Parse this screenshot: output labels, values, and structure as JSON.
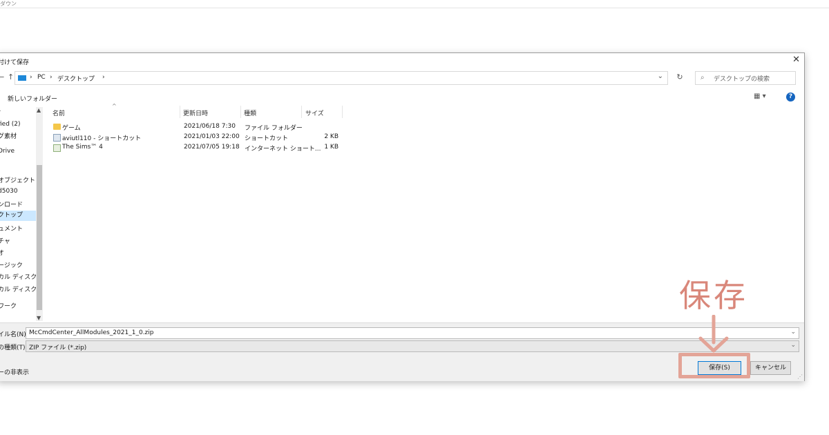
{
  "browser": {
    "tab_label": "ダウン"
  },
  "dialog": {
    "title": "付けて保存",
    "close_glyph": "✕",
    "nav": {
      "back_glyph": "←",
      "up_glyph": "↑",
      "breadcrumb": [
        "PC",
        "デスクトップ"
      ],
      "separator": "›",
      "dropdown_glyph": "⌄",
      "refresh_glyph": "↻",
      "search_placeholder": "デスクトップの検索"
    },
    "toolbar": {
      "new_folder": "新しいフォルダー",
      "view_glyph": "▦ ▾",
      "help_glyph": "?"
    },
    "sidebar": {
      "items": [
        "r",
        "fied (2)",
        "グ素材",
        "Drive",
        "オブジェクト",
        "d5030",
        "ンロード",
        "クトップ",
        "ュメント",
        "チャ",
        "オ",
        "ージック",
        "カル ディスク (C",
        "カル ディスク (C",
        "ワーク"
      ],
      "selected_index": 7
    },
    "columns": {
      "name": "名前",
      "date": "更新日時",
      "type": "種類",
      "size": "サイズ",
      "sort_glyph": "^"
    },
    "files": [
      {
        "name": "ゲーム",
        "date": "2021/06/18 7:30",
        "type": "ファイル フォルダー",
        "size": "",
        "icon": "folder-icon"
      },
      {
        "name": "aviutl110 - ショートカット",
        "date": "2021/01/03 22:00",
        "type": "ショートカット",
        "size": "2 KB",
        "icon": "shortcut-icon"
      },
      {
        "name": "The Sims™ 4",
        "date": "2021/07/05 19:18",
        "type": "インターネット ショート...",
        "size": "1 KB",
        "icon": "internet-shortcut-icon"
      }
    ],
    "footer": {
      "filename_label": "イル名(N):",
      "filename_value": "McCmdCenter_AllModules_2021_1_0.zip",
      "filetype_label": "の種類(T):",
      "filetype_value": "ZIP ファイル (*.zip)",
      "hide_folders": "ーの非表示",
      "save_button": "保存(S)",
      "cancel_button": "キャンセル"
    }
  },
  "annotation": {
    "text": "保存",
    "color": "#d9877a"
  }
}
